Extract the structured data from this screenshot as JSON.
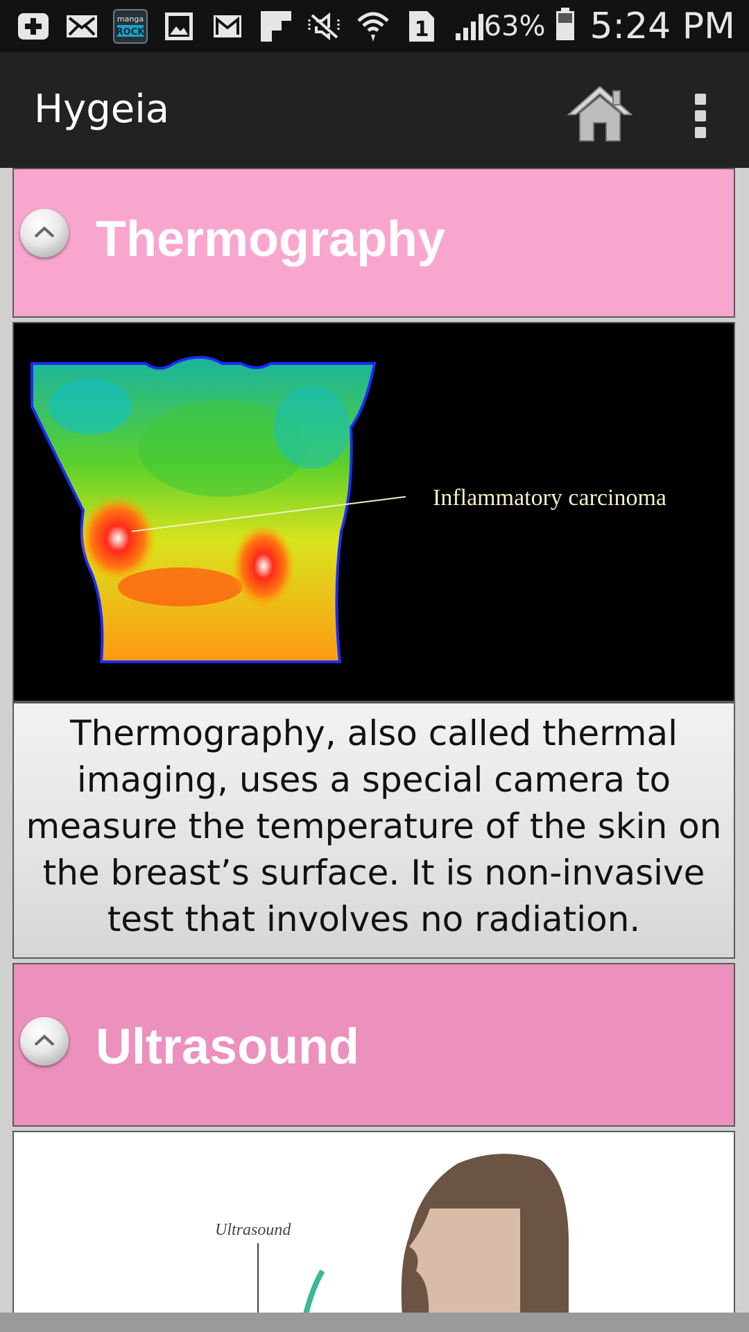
{
  "status_bar": {
    "icons": [
      "add-icon",
      "email-icon",
      "manga-rock-icon",
      "gallery-icon",
      "gmail-icon",
      "flipboard-icon",
      "mute-icon",
      "wifi-icon",
      "sim1-icon",
      "signal-icon"
    ],
    "manga_logo_top": "manga",
    "manga_logo_bottom": "ROCK",
    "sim_label": "1",
    "battery": "63%",
    "time": "5:24 PM"
  },
  "action_bar": {
    "title": "Hygeia",
    "home_icon": "home-icon",
    "overflow_icon": "overflow-menu-icon"
  },
  "sections": [
    {
      "title": "Thermography",
      "image_annotation": "Inflammatory carcinoma",
      "description": "Thermography, also called thermal imaging, uses a special camera to measure the temperature of the skin on the breast’s surface. It is non-invasive test that involves no radiation."
    },
    {
      "title": "Ultrasound",
      "image_label": "Ultrasound"
    }
  ],
  "colors": {
    "section_header_1": "#f9a6cf",
    "section_header_2": "#ec90bd",
    "action_bar": "#222222",
    "status_bar": "#121212"
  }
}
